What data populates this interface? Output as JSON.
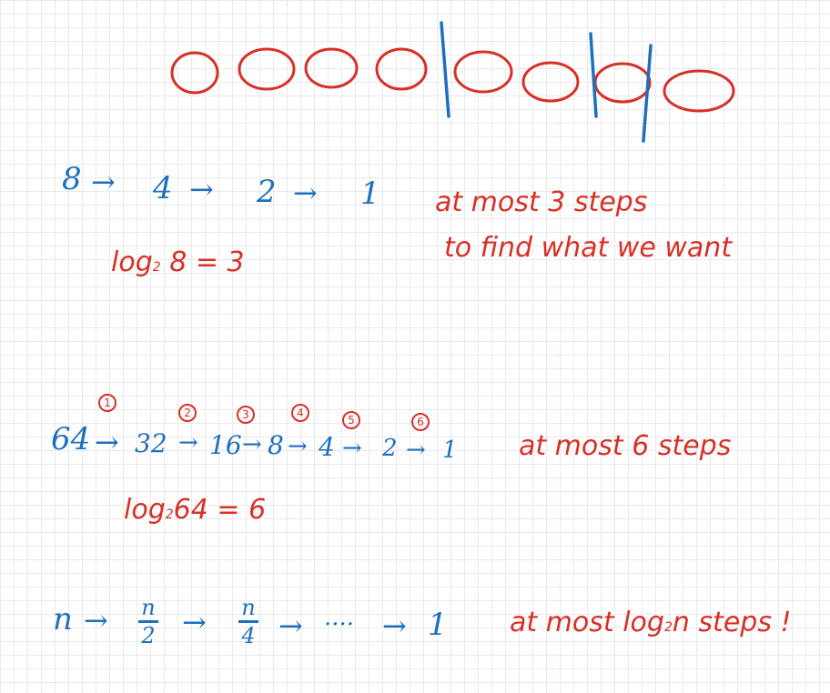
{
  "row1": {
    "chain": [
      "8",
      "4",
      "2",
      "1"
    ],
    "arrow": "→"
  },
  "row1_note": {
    "line1": "at most 3 steps",
    "line2": "to find what we want"
  },
  "row1_log": {
    "base": "2",
    "arg": "8",
    "result": "3",
    "log_word": "log",
    "eq": "="
  },
  "row2": {
    "chain": [
      "64",
      "32",
      "16",
      "8",
      "4",
      "2",
      "1"
    ],
    "markers": [
      "1",
      "2",
      "3",
      "4",
      "5",
      "6"
    ],
    "arrow": "→"
  },
  "row2_note": {
    "text": "at most 6 steps"
  },
  "row2_log": {
    "base": "2",
    "arg": "64",
    "result": "6",
    "log_word": "log",
    "eq": "="
  },
  "row3": {
    "start": "n",
    "frac1": {
      "num": "n",
      "den": "2"
    },
    "frac2": {
      "num": "n",
      "den": "4"
    },
    "dots": "····",
    "end": "1",
    "arrow": "→"
  },
  "row3_note": {
    "prefix": "at most",
    "log_word": "log",
    "base": "2",
    "arg": "n",
    "suffix": "steps !"
  },
  "colors": {
    "blue": "#1f6fbf",
    "red": "#d83026",
    "grid": "#e9e9ee"
  }
}
